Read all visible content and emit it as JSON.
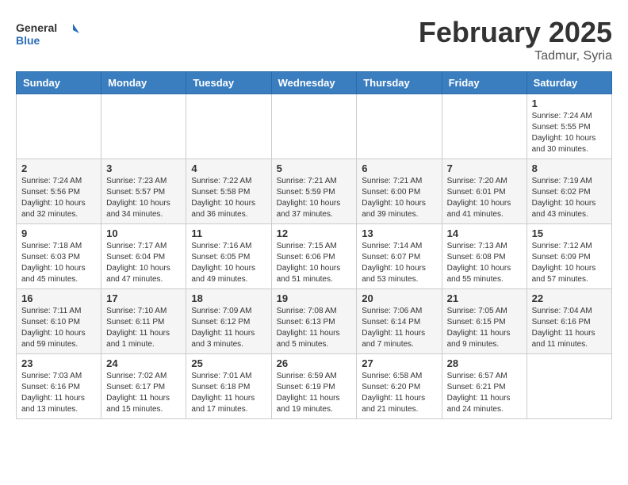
{
  "header": {
    "logo_general": "General",
    "logo_blue": "Blue",
    "month_title": "February 2025",
    "location": "Tadmur, Syria"
  },
  "weekdays": [
    "Sunday",
    "Monday",
    "Tuesday",
    "Wednesday",
    "Thursday",
    "Friday",
    "Saturday"
  ],
  "weeks": [
    [
      {
        "day": "",
        "info": ""
      },
      {
        "day": "",
        "info": ""
      },
      {
        "day": "",
        "info": ""
      },
      {
        "day": "",
        "info": ""
      },
      {
        "day": "",
        "info": ""
      },
      {
        "day": "",
        "info": ""
      },
      {
        "day": "1",
        "info": "Sunrise: 7:24 AM\nSunset: 5:55 PM\nDaylight: 10 hours\nand 30 minutes."
      }
    ],
    [
      {
        "day": "2",
        "info": "Sunrise: 7:24 AM\nSunset: 5:56 PM\nDaylight: 10 hours\nand 32 minutes."
      },
      {
        "day": "3",
        "info": "Sunrise: 7:23 AM\nSunset: 5:57 PM\nDaylight: 10 hours\nand 34 minutes."
      },
      {
        "day": "4",
        "info": "Sunrise: 7:22 AM\nSunset: 5:58 PM\nDaylight: 10 hours\nand 36 minutes."
      },
      {
        "day": "5",
        "info": "Sunrise: 7:21 AM\nSunset: 5:59 PM\nDaylight: 10 hours\nand 37 minutes."
      },
      {
        "day": "6",
        "info": "Sunrise: 7:21 AM\nSunset: 6:00 PM\nDaylight: 10 hours\nand 39 minutes."
      },
      {
        "day": "7",
        "info": "Sunrise: 7:20 AM\nSunset: 6:01 PM\nDaylight: 10 hours\nand 41 minutes."
      },
      {
        "day": "8",
        "info": "Sunrise: 7:19 AM\nSunset: 6:02 PM\nDaylight: 10 hours\nand 43 minutes."
      }
    ],
    [
      {
        "day": "9",
        "info": "Sunrise: 7:18 AM\nSunset: 6:03 PM\nDaylight: 10 hours\nand 45 minutes."
      },
      {
        "day": "10",
        "info": "Sunrise: 7:17 AM\nSunset: 6:04 PM\nDaylight: 10 hours\nand 47 minutes."
      },
      {
        "day": "11",
        "info": "Sunrise: 7:16 AM\nSunset: 6:05 PM\nDaylight: 10 hours\nand 49 minutes."
      },
      {
        "day": "12",
        "info": "Sunrise: 7:15 AM\nSunset: 6:06 PM\nDaylight: 10 hours\nand 51 minutes."
      },
      {
        "day": "13",
        "info": "Sunrise: 7:14 AM\nSunset: 6:07 PM\nDaylight: 10 hours\nand 53 minutes."
      },
      {
        "day": "14",
        "info": "Sunrise: 7:13 AM\nSunset: 6:08 PM\nDaylight: 10 hours\nand 55 minutes."
      },
      {
        "day": "15",
        "info": "Sunrise: 7:12 AM\nSunset: 6:09 PM\nDaylight: 10 hours\nand 57 minutes."
      }
    ],
    [
      {
        "day": "16",
        "info": "Sunrise: 7:11 AM\nSunset: 6:10 PM\nDaylight: 10 hours\nand 59 minutes."
      },
      {
        "day": "17",
        "info": "Sunrise: 7:10 AM\nSunset: 6:11 PM\nDaylight: 11 hours\nand 1 minute."
      },
      {
        "day": "18",
        "info": "Sunrise: 7:09 AM\nSunset: 6:12 PM\nDaylight: 11 hours\nand 3 minutes."
      },
      {
        "day": "19",
        "info": "Sunrise: 7:08 AM\nSunset: 6:13 PM\nDaylight: 11 hours\nand 5 minutes."
      },
      {
        "day": "20",
        "info": "Sunrise: 7:06 AM\nSunset: 6:14 PM\nDaylight: 11 hours\nand 7 minutes."
      },
      {
        "day": "21",
        "info": "Sunrise: 7:05 AM\nSunset: 6:15 PM\nDaylight: 11 hours\nand 9 minutes."
      },
      {
        "day": "22",
        "info": "Sunrise: 7:04 AM\nSunset: 6:16 PM\nDaylight: 11 hours\nand 11 minutes."
      }
    ],
    [
      {
        "day": "23",
        "info": "Sunrise: 7:03 AM\nSunset: 6:16 PM\nDaylight: 11 hours\nand 13 minutes."
      },
      {
        "day": "24",
        "info": "Sunrise: 7:02 AM\nSunset: 6:17 PM\nDaylight: 11 hours\nand 15 minutes."
      },
      {
        "day": "25",
        "info": "Sunrise: 7:01 AM\nSunset: 6:18 PM\nDaylight: 11 hours\nand 17 minutes."
      },
      {
        "day": "26",
        "info": "Sunrise: 6:59 AM\nSunset: 6:19 PM\nDaylight: 11 hours\nand 19 minutes."
      },
      {
        "day": "27",
        "info": "Sunrise: 6:58 AM\nSunset: 6:20 PM\nDaylight: 11 hours\nand 21 minutes."
      },
      {
        "day": "28",
        "info": "Sunrise: 6:57 AM\nSunset: 6:21 PM\nDaylight: 11 hours\nand 24 minutes."
      },
      {
        "day": "",
        "info": ""
      }
    ]
  ]
}
